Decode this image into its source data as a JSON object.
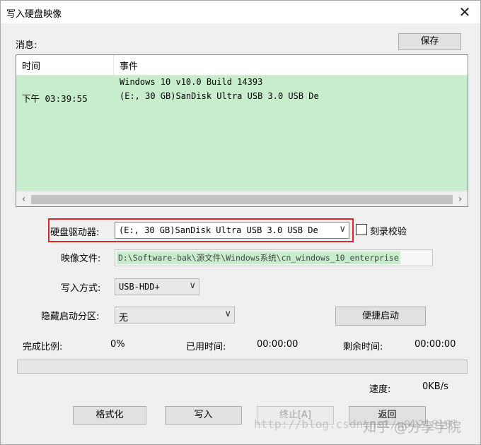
{
  "window": {
    "title": "写入硬盘映像"
  },
  "messages": {
    "label": "消息:",
    "save_button": "保存",
    "columns": [
      "时间",
      "事件"
    ],
    "rows": [
      {
        "time": "下午 03:39:55",
        "event_line1": "Windows 10 v10.0 Build 14393",
        "event_line2": "(E:, 30 GB)SanDisk Ultra USB 3.0 USB De"
      }
    ]
  },
  "drive": {
    "label": "硬盘驱动器:",
    "value": "(E:, 30 GB)SanDisk Ultra USB 3.0 USB De",
    "verify_label": "刻录校验",
    "verify_checked": false
  },
  "image_file": {
    "label": "映像文件:",
    "value": "D:\\Software-bak\\源文件\\Windows系统\\cn_windows_10_enterprise"
  },
  "write_method": {
    "label": "写入方式:",
    "value": "USB-HDD+"
  },
  "hidden_partition": {
    "label": "隐藏启动分区:",
    "value": "无"
  },
  "quick_boot_button": "便捷启动",
  "status": {
    "progress_label": "完成比例:",
    "progress_value": "0%",
    "progress_fraction": 0,
    "elapsed_label": "已用时间:",
    "elapsed_value": "00:00:00",
    "remaining_label": "剩余时间:",
    "remaining_value": "00:00:00",
    "speed_label": "速度:",
    "speed_value": "0KB/s"
  },
  "buttons": {
    "format": "格式化",
    "write": "写入",
    "abort": "终止[A]",
    "back": "返回"
  },
  "watermark": {
    "url": "http://blog.csdn.net/u0l2l8l0l",
    "brand": "知乎 @分享学院"
  },
  "colors": {
    "log_bg": "#c7edcc",
    "highlight_border": "#e0262b"
  }
}
